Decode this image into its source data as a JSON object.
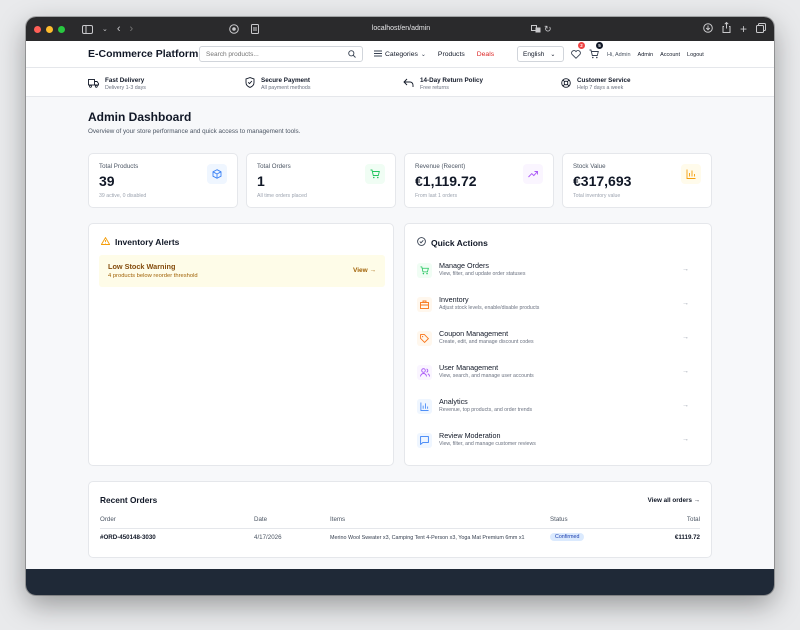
{
  "browser": {
    "url": "localhost/en/admin",
    "traffic_lights": {
      "close": "#ff5f57",
      "minimize": "#febc2e",
      "maximize": "#28c840"
    }
  },
  "header": {
    "logo": "E-Commerce Platform",
    "search_placeholder": "Search products...",
    "categories_label": "Categories",
    "products_label": "Products",
    "deals_label": "Deals",
    "language": "English",
    "wishlist_count": "2",
    "cart_count": "5",
    "greeting": "Hi, Admin",
    "admin_link": "Admin",
    "account_link": "Account",
    "logout_link": "Logout"
  },
  "benefits": [
    {
      "icon": "truck-icon",
      "title": "Fast Delivery",
      "subtitle": "Delivery 1-3 days"
    },
    {
      "icon": "shield-icon",
      "title": "Secure Payment",
      "subtitle": "All payment methods"
    },
    {
      "icon": "return-arrow-icon",
      "title": "14-Day Return Policy",
      "subtitle": "Free returns"
    },
    {
      "icon": "support-icon",
      "title": "Customer Service",
      "subtitle": "Help 7 days a week"
    }
  ],
  "page": {
    "title": "Admin Dashboard",
    "subtitle": "Overview of your store performance and quick access to management tools."
  },
  "stats": [
    {
      "label": "Total Products",
      "value": "39",
      "note": "39 active, 0 disabled",
      "icon": "box-icon",
      "color": "#3b82f6",
      "bg": "#eff6ff"
    },
    {
      "label": "Total Orders",
      "value": "1",
      "note": "All time orders placed",
      "icon": "cart-icon",
      "color": "#22c55e",
      "bg": "#f0fdf4"
    },
    {
      "label": "Revenue (Recent)",
      "value": "€1,119.72",
      "note": "From last 1 orders",
      "icon": "trending-up-icon",
      "color": "#a855f7",
      "bg": "#faf5ff"
    },
    {
      "label": "Stock Value",
      "value": "€317,693",
      "note": "Total inventory value",
      "icon": "bar-chart-icon",
      "color": "#f59e0b",
      "bg": "#fffbeb"
    }
  ],
  "inventory_alerts": {
    "title": "Inventory Alerts",
    "alert_title": "Low Stock Warning",
    "alert_subtitle": "4 products below reorder threshold",
    "view_label": "View"
  },
  "quick_actions": {
    "title": "Quick Actions",
    "items": [
      {
        "title": "Manage Orders",
        "subtitle": "View, filter, and update order statuses",
        "icon": "cart-icon",
        "color": "#22c55e",
        "bg": "#f0fdf4"
      },
      {
        "title": "Inventory",
        "subtitle": "Adjust stock levels, enable/disable products",
        "icon": "inventory-icon",
        "color": "#f97316",
        "bg": "#fff7ed"
      },
      {
        "title": "Coupon Management",
        "subtitle": "Create, edit, and manage discount codes",
        "icon": "tag-icon",
        "color": "#f97316",
        "bg": "#fff7ed"
      },
      {
        "title": "User Management",
        "subtitle": "View, search, and manage user accounts",
        "icon": "users-icon",
        "color": "#a855f7",
        "bg": "#faf5ff"
      },
      {
        "title": "Analytics",
        "subtitle": "Revenue, top products, and order trends",
        "icon": "analytics-icon",
        "color": "#3b82f6",
        "bg": "#eff6ff"
      },
      {
        "title": "Review Moderation",
        "subtitle": "View, filter, and manage customer reviews",
        "icon": "message-icon",
        "color": "#3b82f6",
        "bg": "#eff6ff"
      }
    ]
  },
  "recent_orders": {
    "title": "Recent Orders",
    "view_all": "View all orders",
    "columns": [
      "Order",
      "Date",
      "Items",
      "Status",
      "Total"
    ],
    "rows": [
      {
        "order": "#ORD-450148-3030",
        "date": "4/17/2026",
        "items": "Merino Wool Sweater x3, Camping Tent 4-Person x3, Yoga Mat Premium 6mm x1",
        "status": "Confirmed",
        "total": "€1119.72"
      }
    ]
  }
}
